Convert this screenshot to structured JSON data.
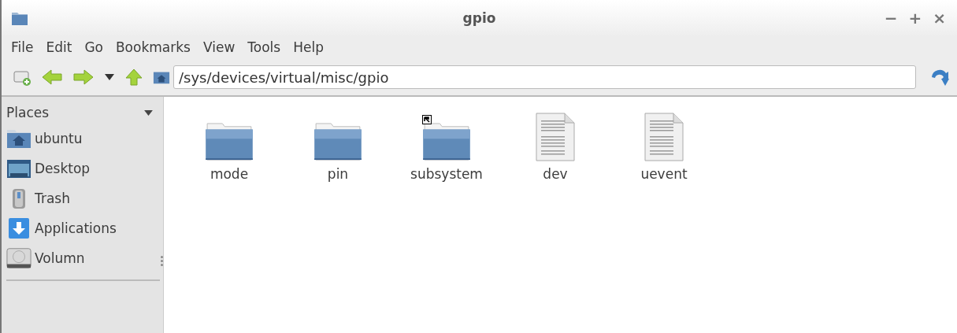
{
  "window": {
    "title": "gpio",
    "controls": [
      "−",
      "+",
      "×"
    ]
  },
  "menu": [
    "File",
    "Edit",
    "Go",
    "Bookmarks",
    "View",
    "Tools",
    "Help"
  ],
  "location": {
    "value": "/sys/devices/virtual/misc/gpio"
  },
  "sidebar": {
    "title": "Places",
    "items": [
      {
        "label": "ubuntu",
        "kind": "home"
      },
      {
        "label": "Desktop",
        "kind": "desktop"
      },
      {
        "label": "Trash",
        "kind": "trash"
      },
      {
        "label": "Applications",
        "kind": "applications"
      },
      {
        "label": "Volumn",
        "kind": "drive"
      }
    ]
  },
  "files": [
    {
      "name": "mode",
      "kind": "folder",
      "link": false
    },
    {
      "name": "pin",
      "kind": "folder",
      "link": false
    },
    {
      "name": "subsystem",
      "kind": "folder",
      "link": true
    },
    {
      "name": "dev",
      "kind": "file",
      "link": false
    },
    {
      "name": "uevent",
      "kind": "file",
      "link": false
    }
  ]
}
